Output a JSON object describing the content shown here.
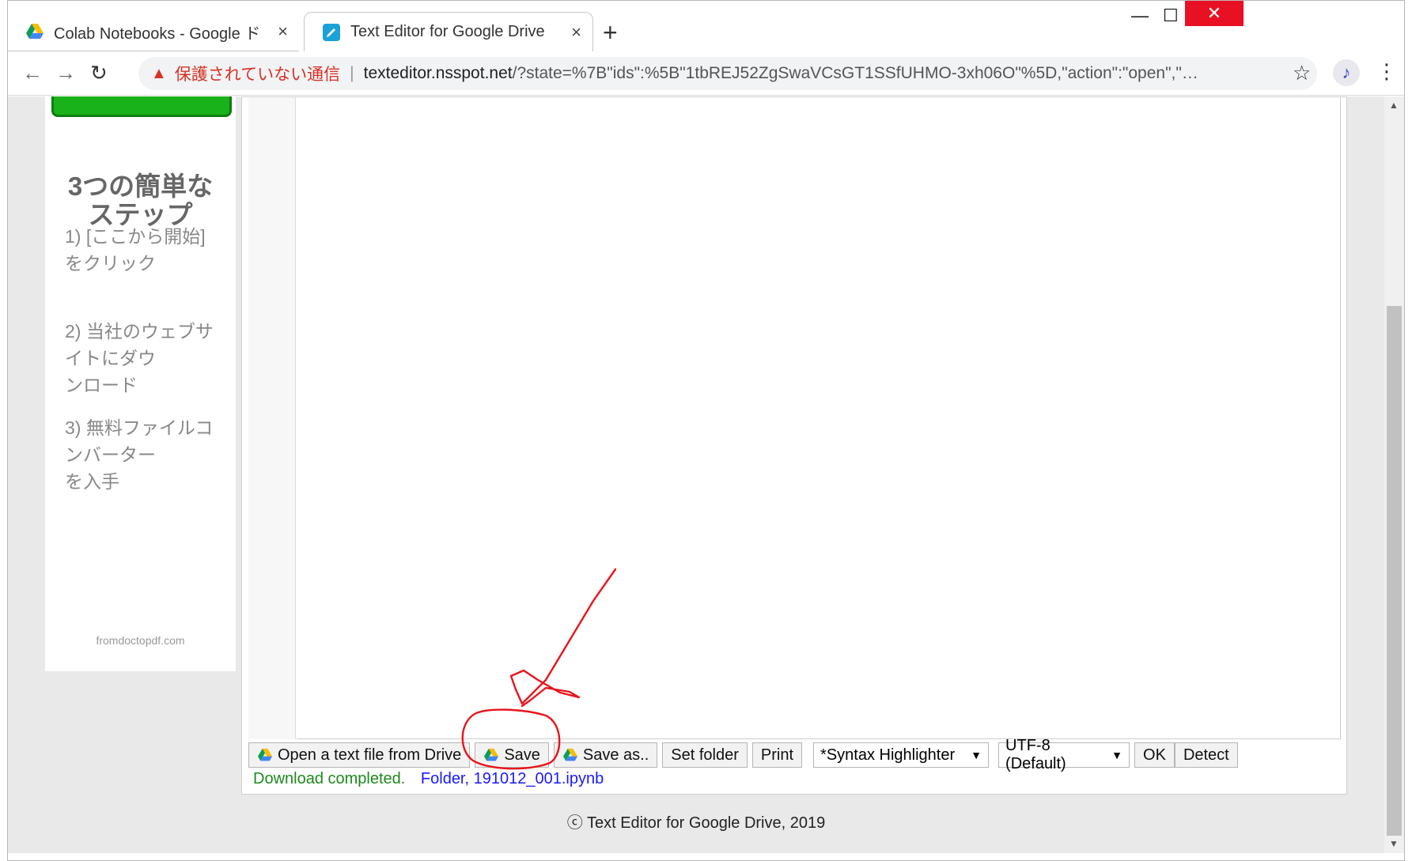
{
  "browser": {
    "tabs": [
      {
        "title": "Colab Notebooks - Google ドラ",
        "close": "×"
      },
      {
        "title": "Text Editor for Google Drive",
        "close": "×"
      }
    ],
    "new_tab": "+",
    "window_controls": {
      "minimize": "—",
      "maximize": "☐",
      "close": "✕"
    },
    "address": {
      "warning_text": "保護されていない通信",
      "separator": "|",
      "host": "texteditor.nsspot.net",
      "path": "/?state=%7B\"ids\":%5B\"1tbREJ52ZgSwaVCsGT1SSfUHMO-3xh06O\"%5D,\"action\":\"open\",\"…"
    }
  },
  "ad": {
    "title": "3つの簡単な\nステップ",
    "steps": [
      "1) [ここから開始]\n   をクリック",
      "2) 当社のウェブサ\n  イトにダウ\n   ンロード",
      "3) 無料ファイルコ\n   ンバーター\n   を入手"
    ],
    "footer": "fromdoctopdf.com"
  },
  "editor": {
    "buttons": {
      "open": "Open a text file from Drive",
      "save": "Save",
      "save_as": "Save as..",
      "set_folder": "Set folder",
      "print": "Print",
      "ok": "OK",
      "detect": "Detect"
    },
    "syntax_select": "*Syntax Highlighter",
    "encoding_select": "UTF-8 (Default)",
    "status": {
      "message": "Download completed.",
      "folder_file": "Folder, 191012_001.ipynb"
    }
  },
  "footer": "ⓒ Text Editor for Google Drive, 2019",
  "colors": {
    "annotation": "#e8141c",
    "status_ok": "#1c8a1c",
    "link": "#1a1aff",
    "insecure": "#d93025"
  }
}
